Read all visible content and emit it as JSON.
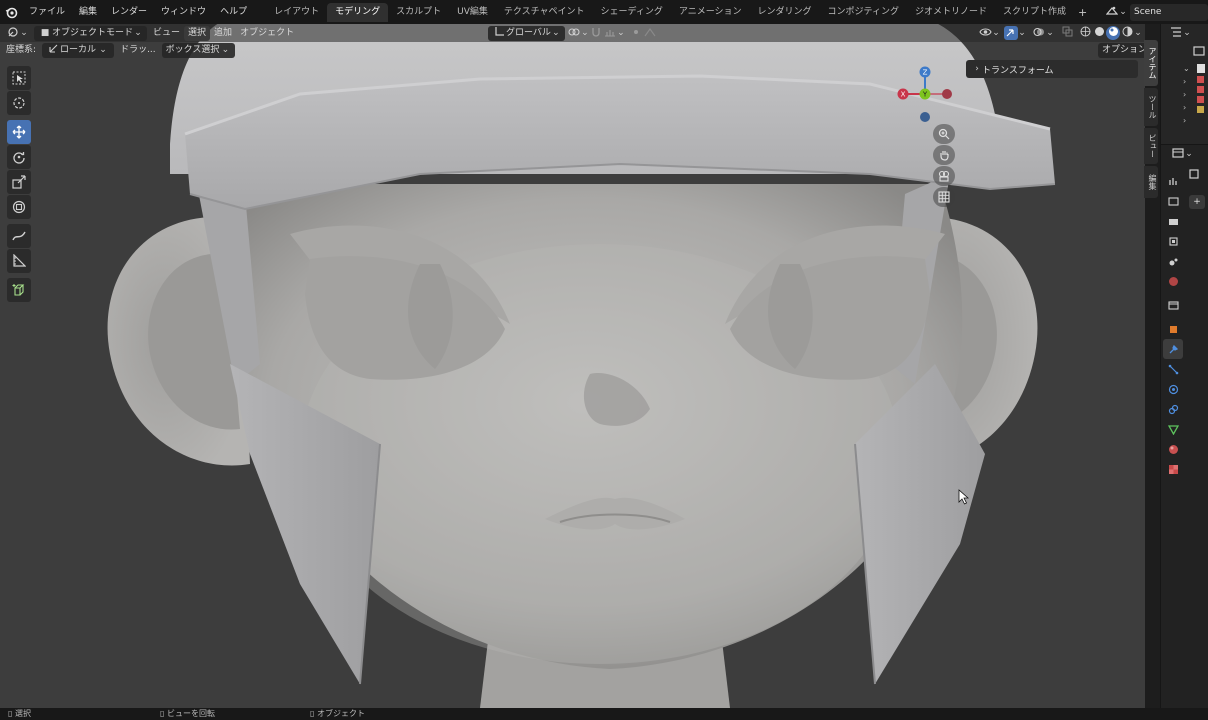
{
  "top_menu": {
    "items": [
      "ファイル",
      "編集",
      "レンダー",
      "ウィンドウ",
      "ヘルプ"
    ],
    "workspace_tabs": [
      "レイアウト",
      "モデリング",
      "スカルプト",
      "UV編集",
      "テクスチャペイント",
      "シェーディング",
      "アニメーション",
      "レンダリング",
      "コンポジティング",
      "ジオメトリノード",
      "スクリプト作成"
    ],
    "active_workspace": "モデリング",
    "add_tab": "+",
    "scene_name": "Scene"
  },
  "viewport_header": {
    "mode": "オブジェクトモード",
    "menus": [
      "ビュー",
      "選択",
      "追加",
      "オブジェクト"
    ],
    "transform_orientation": "グローバル",
    "options": "オプション"
  },
  "tool_settings": {
    "orientation_label": "座標系:",
    "orientation_value": "ローカル",
    "drag_label": "ドラッ...",
    "drag_value": "ボックス選択"
  },
  "gizmo": {
    "z": "Z",
    "y": "Y",
    "x": "X"
  },
  "sidebar": {
    "panel_title": "トランスフォーム",
    "tabs": [
      "アイテム",
      "ツール",
      "ビュー",
      "編集"
    ],
    "active_tab": "アイテム"
  },
  "statusbar": {
    "left": "選択",
    "middle": "ビューを回転",
    "right": "オブジェクト"
  },
  "colors": {
    "accent": "#4772b3",
    "axis_x": "#c8354a",
    "axis_y": "#7ec51f",
    "axis_z": "#3d7ac9",
    "viewport_bg": "#3d3d3d"
  }
}
